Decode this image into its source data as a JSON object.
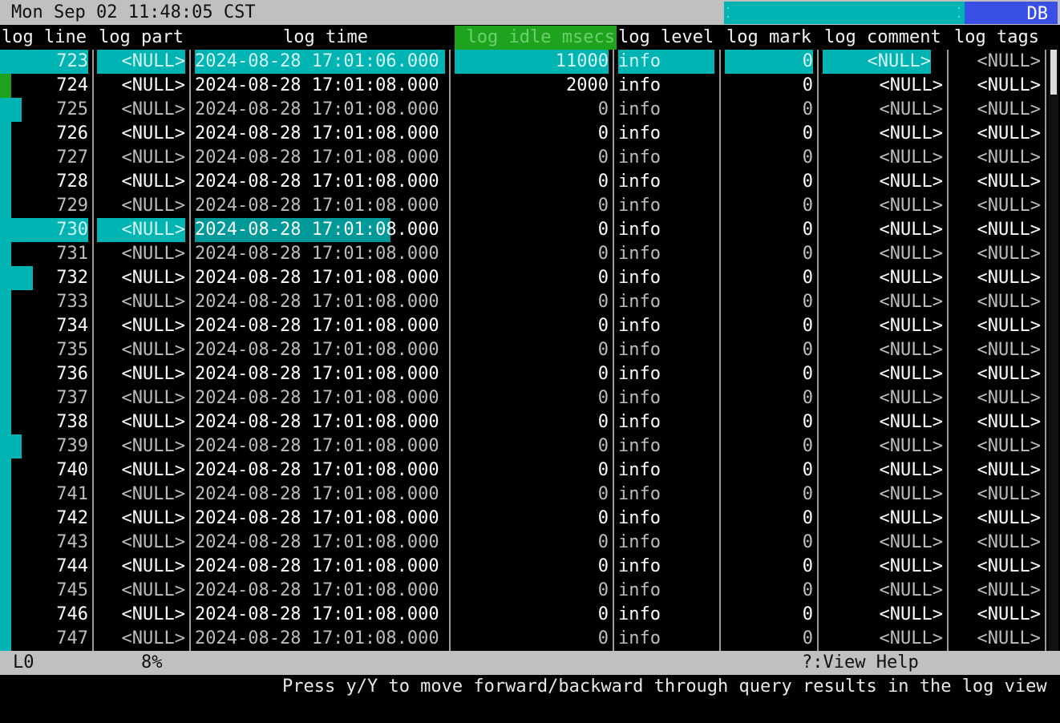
{
  "topbar": {
    "clock": "Mon Sep 02 11:48:05 CST",
    "db_tab": "DB"
  },
  "columns": [
    "log line",
    "log part",
    "log time",
    "log idle msecs",
    "log level",
    "log mark",
    "log comment",
    "log tags"
  ],
  "rows": [
    {
      "line": "723",
      "part": "<NULL>",
      "time": "2024-08-28 17:01:06.000",
      "idle": "11000",
      "level": "info",
      "mark": "0",
      "comment": "<NULL>",
      "tags": "<NULL>"
    },
    {
      "line": "724",
      "part": "<NULL>",
      "time": "2024-08-28 17:01:08.000",
      "idle": "2000",
      "level": "info",
      "mark": "0",
      "comment": "<NULL>",
      "tags": "<NULL>"
    },
    {
      "line": "725",
      "part": "<NULL>",
      "time": "2024-08-28 17:01:08.000",
      "idle": "0",
      "level": "info",
      "mark": "0",
      "comment": "<NULL>",
      "tags": "<NULL>"
    },
    {
      "line": "726",
      "part": "<NULL>",
      "time": "2024-08-28 17:01:08.000",
      "idle": "0",
      "level": "info",
      "mark": "0",
      "comment": "<NULL>",
      "tags": "<NULL>"
    },
    {
      "line": "727",
      "part": "<NULL>",
      "time": "2024-08-28 17:01:08.000",
      "idle": "0",
      "level": "info",
      "mark": "0",
      "comment": "<NULL>",
      "tags": "<NULL>"
    },
    {
      "line": "728",
      "part": "<NULL>",
      "time": "2024-08-28 17:01:08.000",
      "idle": "0",
      "level": "info",
      "mark": "0",
      "comment": "<NULL>",
      "tags": "<NULL>"
    },
    {
      "line": "729",
      "part": "<NULL>",
      "time": "2024-08-28 17:01:08.000",
      "idle": "0",
      "level": "info",
      "mark": "0",
      "comment": "<NULL>",
      "tags": "<NULL>"
    },
    {
      "line": "730",
      "part": "<NULL>",
      "time": "2024-08-28 17:01:08.000",
      "idle": "0",
      "level": "info",
      "mark": "0",
      "comment": "<NULL>",
      "tags": "<NULL>"
    },
    {
      "line": "731",
      "part": "<NULL>",
      "time": "2024-08-28 17:01:08.000",
      "idle": "0",
      "level": "info",
      "mark": "0",
      "comment": "<NULL>",
      "tags": "<NULL>"
    },
    {
      "line": "732",
      "part": "<NULL>",
      "time": "2024-08-28 17:01:08.000",
      "idle": "0",
      "level": "info",
      "mark": "0",
      "comment": "<NULL>",
      "tags": "<NULL>"
    },
    {
      "line": "733",
      "part": "<NULL>",
      "time": "2024-08-28 17:01:08.000",
      "idle": "0",
      "level": "info",
      "mark": "0",
      "comment": "<NULL>",
      "tags": "<NULL>"
    },
    {
      "line": "734",
      "part": "<NULL>",
      "time": "2024-08-28 17:01:08.000",
      "idle": "0",
      "level": "info",
      "mark": "0",
      "comment": "<NULL>",
      "tags": "<NULL>"
    },
    {
      "line": "735",
      "part": "<NULL>",
      "time": "2024-08-28 17:01:08.000",
      "idle": "0",
      "level": "info",
      "mark": "0",
      "comment": "<NULL>",
      "tags": "<NULL>"
    },
    {
      "line": "736",
      "part": "<NULL>",
      "time": "2024-08-28 17:01:08.000",
      "idle": "0",
      "level": "info",
      "mark": "0",
      "comment": "<NULL>",
      "tags": "<NULL>"
    },
    {
      "line": "737",
      "part": "<NULL>",
      "time": "2024-08-28 17:01:08.000",
      "idle": "0",
      "level": "info",
      "mark": "0",
      "comment": "<NULL>",
      "tags": "<NULL>"
    },
    {
      "line": "738",
      "part": "<NULL>",
      "time": "2024-08-28 17:01:08.000",
      "idle": "0",
      "level": "info",
      "mark": "0",
      "comment": "<NULL>",
      "tags": "<NULL>"
    },
    {
      "line": "739",
      "part": "<NULL>",
      "time": "2024-08-28 17:01:08.000",
      "idle": "0",
      "level": "info",
      "mark": "0",
      "comment": "<NULL>",
      "tags": "<NULL>"
    },
    {
      "line": "740",
      "part": "<NULL>",
      "time": "2024-08-28 17:01:08.000",
      "idle": "0",
      "level": "info",
      "mark": "0",
      "comment": "<NULL>",
      "tags": "<NULL>"
    },
    {
      "line": "741",
      "part": "<NULL>",
      "time": "2024-08-28 17:01:08.000",
      "idle": "0",
      "level": "info",
      "mark": "0",
      "comment": "<NULL>",
      "tags": "<NULL>"
    },
    {
      "line": "742",
      "part": "<NULL>",
      "time": "2024-08-28 17:01:08.000",
      "idle": "0",
      "level": "info",
      "mark": "0",
      "comment": "<NULL>",
      "tags": "<NULL>"
    },
    {
      "line": "743",
      "part": "<NULL>",
      "time": "2024-08-28 17:01:08.000",
      "idle": "0",
      "level": "info",
      "mark": "0",
      "comment": "<NULL>",
      "tags": "<NULL>"
    },
    {
      "line": "744",
      "part": "<NULL>",
      "time": "2024-08-28 17:01:08.000",
      "idle": "0",
      "level": "info",
      "mark": "0",
      "comment": "<NULL>",
      "tags": "<NULL>"
    },
    {
      "line": "745",
      "part": "<NULL>",
      "time": "2024-08-28 17:01:08.000",
      "idle": "0",
      "level": "info",
      "mark": "0",
      "comment": "<NULL>",
      "tags": "<NULL>"
    },
    {
      "line": "746",
      "part": "<NULL>",
      "time": "2024-08-28 17:01:08.000",
      "idle": "0",
      "level": "info",
      "mark": "0",
      "comment": "<NULL>",
      "tags": "<NULL>"
    },
    {
      "line": "747",
      "part": "<NULL>",
      "time": "2024-08-28 17:01:08.000",
      "idle": "0",
      "level": "info",
      "mark": "0",
      "comment": "<NULL>",
      "tags": "<NULL>"
    }
  ],
  "status": {
    "line_indicator": "L0",
    "percent": "8%",
    "help": "?:View Help"
  },
  "hint": "Press y/Y to move forward/backward through query results in the log view",
  "colors": {
    "accent_cyan": "#00b4b4",
    "sort_green": "#1fa31f",
    "db_blue": "#3a4fe6",
    "bar_gray": "#c0c0c0"
  }
}
